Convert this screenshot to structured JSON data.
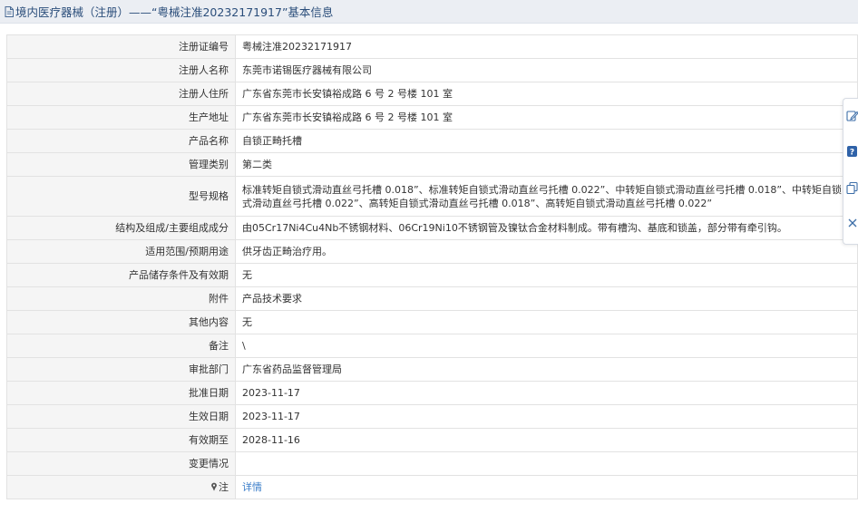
{
  "header": {
    "title": "境内医疗器械（注册）——“粤械注准20232171917”基本信息"
  },
  "rows": [
    {
      "label": "注册证编号",
      "value": "粤械注准20232171917"
    },
    {
      "label": "注册人名称",
      "value": "东莞市诺锡医疗器械有限公司"
    },
    {
      "label": "注册人住所",
      "value": "广东省东莞市长安镇裕成路 6 号 2 号楼 101 室"
    },
    {
      "label": "生产地址",
      "value": "广东省东莞市长安镇裕成路 6 号 2 号楼 101 室"
    },
    {
      "label": "产品名称",
      "value": "自锁正畸托槽"
    },
    {
      "label": "管理类别",
      "value": "第二类"
    },
    {
      "label": "型号规格",
      "value": "标准转矩自锁式滑动直丝弓托槽 0.018”、标准转矩自锁式滑动直丝弓托槽 0.022”、中转矩自锁式滑动直丝弓托槽 0.018”、中转矩自锁式滑动直丝弓托槽 0.022”、高转矩自锁式滑动直丝弓托槽 0.018”、高转矩自锁式滑动直丝弓托槽 0.022”"
    },
    {
      "label": "结构及组成/主要组成成分",
      "value": "由05Cr17Ni4Cu4Nb不锈钢材料、06Cr19Ni10不锈钢管及镍钛合金材料制成。带有槽沟、基底和锁盖，部分带有牵引钩。"
    },
    {
      "label": "适用范围/预期用途",
      "value": "供牙齿正畸治疗用。"
    },
    {
      "label": "产品储存条件及有效期",
      "value": "无"
    },
    {
      "label": "附件",
      "value": "产品技术要求"
    },
    {
      "label": "其他内容",
      "value": "无"
    },
    {
      "label": "备注",
      "value": "\\"
    },
    {
      "label": "审批部门",
      "value": "广东省药品监督管理局"
    },
    {
      "label": "批准日期",
      "value": "2023-11-17"
    },
    {
      "label": "生效日期",
      "value": "2023-11-17"
    },
    {
      "label": "有效期至",
      "value": "2028-11-16"
    },
    {
      "label": "变更情况",
      "value": ""
    },
    {
      "label": "注",
      "value": "详情"
    }
  ],
  "icons": {
    "title": "document-icon",
    "note": "pin-icon",
    "toolbar": [
      "edit-icon",
      "help-icon",
      "copy-icon",
      "close-icon"
    ]
  },
  "colors": {
    "title_text": "#2a4d7a",
    "link": "#3a7dc9",
    "label_bg": "#f5f5f5",
    "titlebar_bg": "#ebeef3"
  }
}
